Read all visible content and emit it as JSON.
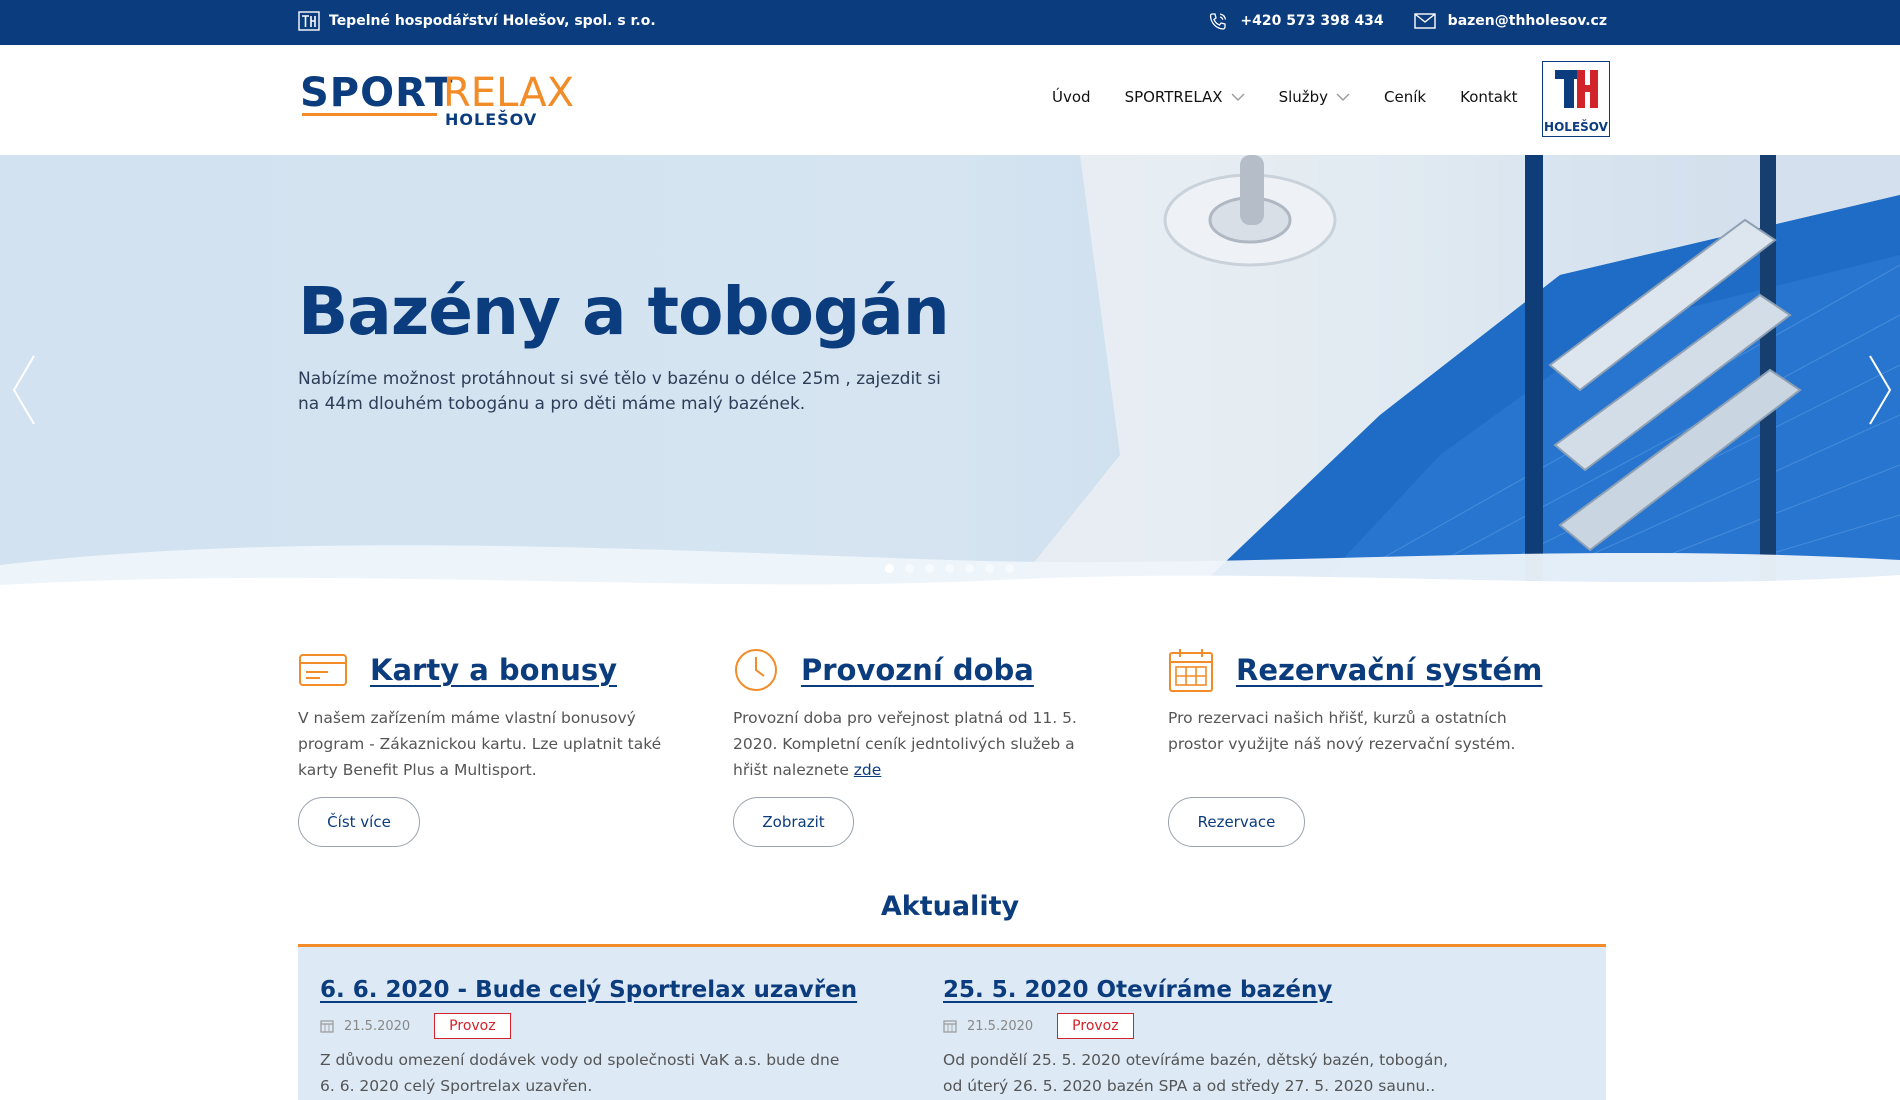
{
  "topbar": {
    "company": "Tepelné hospodářství Holešov, spol. s r.o.",
    "phone": "+420 573 398 434",
    "email": "bazen@thholesov.cz"
  },
  "logo": {
    "word1": "SPORT",
    "word2": "RELAX",
    "sub": "HOLEŠOV"
  },
  "nav": {
    "items": [
      {
        "label": "Úvod"
      },
      {
        "label": "SPORTRELAX"
      },
      {
        "label": "Služby"
      },
      {
        "label": "Ceník"
      },
      {
        "label": "Kontakt"
      }
    ],
    "partner_logo_label": "HOLEŠOV"
  },
  "hero": {
    "title": "Bazény a tobogán",
    "text": "Nabízíme možnost protáhnout si své tělo v bazénu o délce 25m , zajezdit si na 44m dlouhém tobogánu a pro děti máme malý bazének.",
    "slides_count": 7,
    "active_slide": 1
  },
  "features": [
    {
      "icon": "card-icon",
      "title": "Karty a bonusy",
      "text": "V našem zařízením máme vlastní bonusový program - Zákaznickou kartu. Lze uplatnit také karty Benefit Plus a Multisport.",
      "button": "Číst více"
    },
    {
      "icon": "clock-icon",
      "title": "Provozní doba",
      "text": "Provozní doba pro veřejnost platná od 11. 5. 2020. Kompletní ceník jedntolivých služeb a hřišt naleznete",
      "link": "zde",
      "button": "Zobrazit"
    },
    {
      "icon": "calendar-icon",
      "title": "Rezervační systém",
      "text": "Pro rezervaci našich hřišť, kurzů a ostatních prostor využijte náš nový rezervační systém.",
      "button": "Rezervace"
    }
  ],
  "news": {
    "heading": "Aktuality",
    "items": [
      {
        "title": "6. 6. 2020 - Bude celý Sportrelax uzavřen",
        "date": "21.5.2020",
        "tag": "Provoz",
        "text": "Z důvodu omezení dodávek vody od společnosti VaK a.s. bude dne 6. 6. 2020 celý Sportrelax uzavřen."
      },
      {
        "title": "25. 5. 2020 Otevíráme bazény",
        "date": "21.5.2020",
        "tag": "Provoz",
        "text": "Od pondělí 25. 5. 2020 otevíráme bazén, dětský bazén, tobogán, od úterý 26. 5. 2020 bazén SPA a od středy 27. 5. 2020 saunu.."
      }
    ]
  },
  "colors": {
    "brand_blue": "#0b3c7d",
    "accent_orange": "#f28c28",
    "tag_red": "#d2232a"
  }
}
